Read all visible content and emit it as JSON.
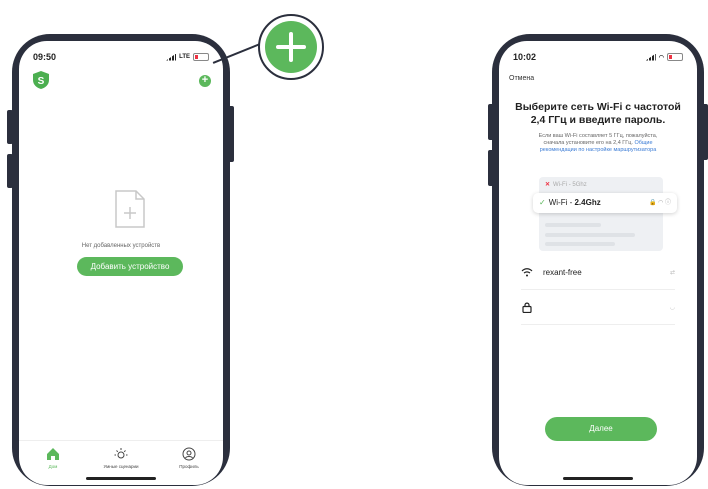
{
  "left_phone": {
    "status": {
      "time": "09:50",
      "network": "LTE"
    },
    "empty_state_text": "Нет добавленных устройств",
    "add_device_label": "Добавить устройство",
    "tabs": [
      {
        "label": "Дом",
        "icon": "home-icon",
        "active": true
      },
      {
        "label": "Умные сценарии",
        "icon": "sun-icon",
        "active": false
      },
      {
        "label": "Профиль",
        "icon": "profile-icon",
        "active": false
      }
    ],
    "accent": "#5cb85c"
  },
  "right_phone": {
    "status": {
      "time": "10:02"
    },
    "cancel_label": "Отмена",
    "title_line1": "Выберите сеть Wi-Fi с частотой",
    "title_line2": "2,4 ГГц и введите пароль.",
    "subtitle_line1": "Если ваш Wi-Fi составляет 5 ГГц, пожалуйста,",
    "subtitle_line2": "сначала установите его на 2,4 ГГц.",
    "subtitle_link_a": "Общие",
    "subtitle_link_b": "рекомендации по настройке маршрутизатора",
    "wifi_5": "Wi-Fi - 5Ghz",
    "wifi_24_prefix": "Wi-Fi - ",
    "wifi_24_band": "2.4Ghz",
    "network_name": "rexant-free",
    "next_label": "Далее"
  }
}
